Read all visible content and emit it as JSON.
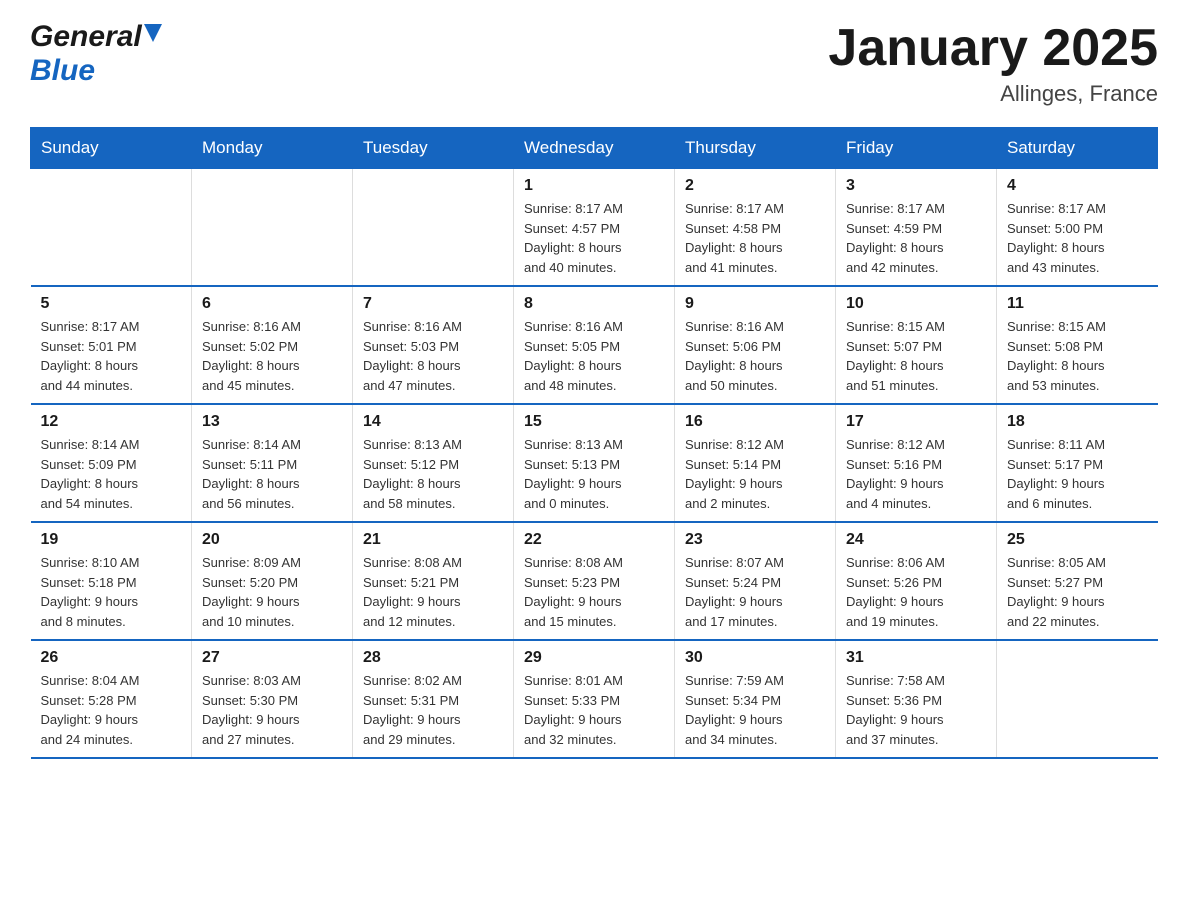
{
  "header": {
    "logo_general": "General",
    "logo_blue": "Blue",
    "month_title": "January 2025",
    "location": "Allinges, France"
  },
  "calendar": {
    "days_of_week": [
      "Sunday",
      "Monday",
      "Tuesday",
      "Wednesday",
      "Thursday",
      "Friday",
      "Saturday"
    ],
    "weeks": [
      [
        {
          "day": "",
          "info": ""
        },
        {
          "day": "",
          "info": ""
        },
        {
          "day": "",
          "info": ""
        },
        {
          "day": "1",
          "info": "Sunrise: 8:17 AM\nSunset: 4:57 PM\nDaylight: 8 hours\nand 40 minutes."
        },
        {
          "day": "2",
          "info": "Sunrise: 8:17 AM\nSunset: 4:58 PM\nDaylight: 8 hours\nand 41 minutes."
        },
        {
          "day": "3",
          "info": "Sunrise: 8:17 AM\nSunset: 4:59 PM\nDaylight: 8 hours\nand 42 minutes."
        },
        {
          "day": "4",
          "info": "Sunrise: 8:17 AM\nSunset: 5:00 PM\nDaylight: 8 hours\nand 43 minutes."
        }
      ],
      [
        {
          "day": "5",
          "info": "Sunrise: 8:17 AM\nSunset: 5:01 PM\nDaylight: 8 hours\nand 44 minutes."
        },
        {
          "day": "6",
          "info": "Sunrise: 8:16 AM\nSunset: 5:02 PM\nDaylight: 8 hours\nand 45 minutes."
        },
        {
          "day": "7",
          "info": "Sunrise: 8:16 AM\nSunset: 5:03 PM\nDaylight: 8 hours\nand 47 minutes."
        },
        {
          "day": "8",
          "info": "Sunrise: 8:16 AM\nSunset: 5:05 PM\nDaylight: 8 hours\nand 48 minutes."
        },
        {
          "day": "9",
          "info": "Sunrise: 8:16 AM\nSunset: 5:06 PM\nDaylight: 8 hours\nand 50 minutes."
        },
        {
          "day": "10",
          "info": "Sunrise: 8:15 AM\nSunset: 5:07 PM\nDaylight: 8 hours\nand 51 minutes."
        },
        {
          "day": "11",
          "info": "Sunrise: 8:15 AM\nSunset: 5:08 PM\nDaylight: 8 hours\nand 53 minutes."
        }
      ],
      [
        {
          "day": "12",
          "info": "Sunrise: 8:14 AM\nSunset: 5:09 PM\nDaylight: 8 hours\nand 54 minutes."
        },
        {
          "day": "13",
          "info": "Sunrise: 8:14 AM\nSunset: 5:11 PM\nDaylight: 8 hours\nand 56 minutes."
        },
        {
          "day": "14",
          "info": "Sunrise: 8:13 AM\nSunset: 5:12 PM\nDaylight: 8 hours\nand 58 minutes."
        },
        {
          "day": "15",
          "info": "Sunrise: 8:13 AM\nSunset: 5:13 PM\nDaylight: 9 hours\nand 0 minutes."
        },
        {
          "day": "16",
          "info": "Sunrise: 8:12 AM\nSunset: 5:14 PM\nDaylight: 9 hours\nand 2 minutes."
        },
        {
          "day": "17",
          "info": "Sunrise: 8:12 AM\nSunset: 5:16 PM\nDaylight: 9 hours\nand 4 minutes."
        },
        {
          "day": "18",
          "info": "Sunrise: 8:11 AM\nSunset: 5:17 PM\nDaylight: 9 hours\nand 6 minutes."
        }
      ],
      [
        {
          "day": "19",
          "info": "Sunrise: 8:10 AM\nSunset: 5:18 PM\nDaylight: 9 hours\nand 8 minutes."
        },
        {
          "day": "20",
          "info": "Sunrise: 8:09 AM\nSunset: 5:20 PM\nDaylight: 9 hours\nand 10 minutes."
        },
        {
          "day": "21",
          "info": "Sunrise: 8:08 AM\nSunset: 5:21 PM\nDaylight: 9 hours\nand 12 minutes."
        },
        {
          "day": "22",
          "info": "Sunrise: 8:08 AM\nSunset: 5:23 PM\nDaylight: 9 hours\nand 15 minutes."
        },
        {
          "day": "23",
          "info": "Sunrise: 8:07 AM\nSunset: 5:24 PM\nDaylight: 9 hours\nand 17 minutes."
        },
        {
          "day": "24",
          "info": "Sunrise: 8:06 AM\nSunset: 5:26 PM\nDaylight: 9 hours\nand 19 minutes."
        },
        {
          "day": "25",
          "info": "Sunrise: 8:05 AM\nSunset: 5:27 PM\nDaylight: 9 hours\nand 22 minutes."
        }
      ],
      [
        {
          "day": "26",
          "info": "Sunrise: 8:04 AM\nSunset: 5:28 PM\nDaylight: 9 hours\nand 24 minutes."
        },
        {
          "day": "27",
          "info": "Sunrise: 8:03 AM\nSunset: 5:30 PM\nDaylight: 9 hours\nand 27 minutes."
        },
        {
          "day": "28",
          "info": "Sunrise: 8:02 AM\nSunset: 5:31 PM\nDaylight: 9 hours\nand 29 minutes."
        },
        {
          "day": "29",
          "info": "Sunrise: 8:01 AM\nSunset: 5:33 PM\nDaylight: 9 hours\nand 32 minutes."
        },
        {
          "day": "30",
          "info": "Sunrise: 7:59 AM\nSunset: 5:34 PM\nDaylight: 9 hours\nand 34 minutes."
        },
        {
          "day": "31",
          "info": "Sunrise: 7:58 AM\nSunset: 5:36 PM\nDaylight: 9 hours\nand 37 minutes."
        },
        {
          "day": "",
          "info": ""
        }
      ]
    ]
  }
}
